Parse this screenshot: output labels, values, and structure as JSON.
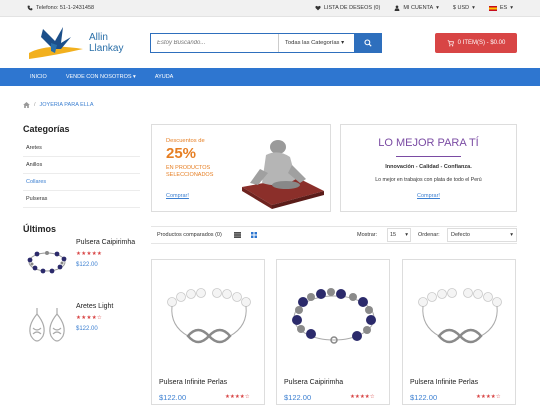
{
  "topbar": {
    "phone": "Telefono: 51-1-2431458",
    "wishlist": "LISTA DE DESEOS (0)",
    "account": "MI CUENTA",
    "currency": "$ USD",
    "language": "ES"
  },
  "logo": {
    "line1": "Allin",
    "line2": "Llankay"
  },
  "search": {
    "placeholder": "Estoy Buscando...",
    "category": "Todas las Categorías"
  },
  "cart": {
    "label": "0 ITEM(S) - $0.00"
  },
  "nav": [
    "INICIO",
    "VENDE CON NOSOTROS",
    "AYUDA"
  ],
  "breadcrumb": "JOYERIA PARA ELLA",
  "categories": {
    "title": "Categorías",
    "items": [
      "Aretes",
      "Anillos",
      "Collares",
      "Pulseras"
    ]
  },
  "latest": {
    "title": "Últimos",
    "products": [
      {
        "name": "Pulsera Caipirimha",
        "stars": "★★★★★",
        "price": "$122.00"
      },
      {
        "name": "Aretes Light",
        "stars": "★★★★☆",
        "price": "$122.00"
      }
    ]
  },
  "banner_left": {
    "title": "Descuentos de",
    "percent": "25%",
    "subtitle": "EN PRODUCTOS SELECCIONADOS",
    "link": "Comprar!"
  },
  "banner_right": {
    "title": "LO MEJOR PARA TÍ",
    "subtitle": "Innovación - Calidad - Confianza.",
    "description": "Lo mejor en trabajos con plata de todo el Perú",
    "link": "Comprar!"
  },
  "toolbar": {
    "compare": "Productos comparados (0)",
    "show_label": "Mostrar:",
    "show_value": "15",
    "order_label": "Ordenar:",
    "order_value": "Defecto"
  },
  "products": [
    {
      "name": "Pulsera Infinite Perlas",
      "price": "$122.00",
      "stars": "★★★★☆"
    },
    {
      "name": "Pulsera Caipirimha",
      "price": "$122.00",
      "stars": "★★★★☆"
    },
    {
      "name": "Pulsera Infinite Perlas",
      "price": "$122.00",
      "stars": "★★★★☆"
    }
  ],
  "colors": {
    "accent": "#2e76d0",
    "cart": "#d84545",
    "offer": "#e67e22",
    "title_purple": "#7a4ba3"
  },
  "icons": [
    "phone-icon",
    "heart-icon",
    "user-icon",
    "flag-es-icon",
    "search-icon",
    "cart-icon",
    "home-icon",
    "list-view-icon",
    "grid-view-icon"
  ]
}
